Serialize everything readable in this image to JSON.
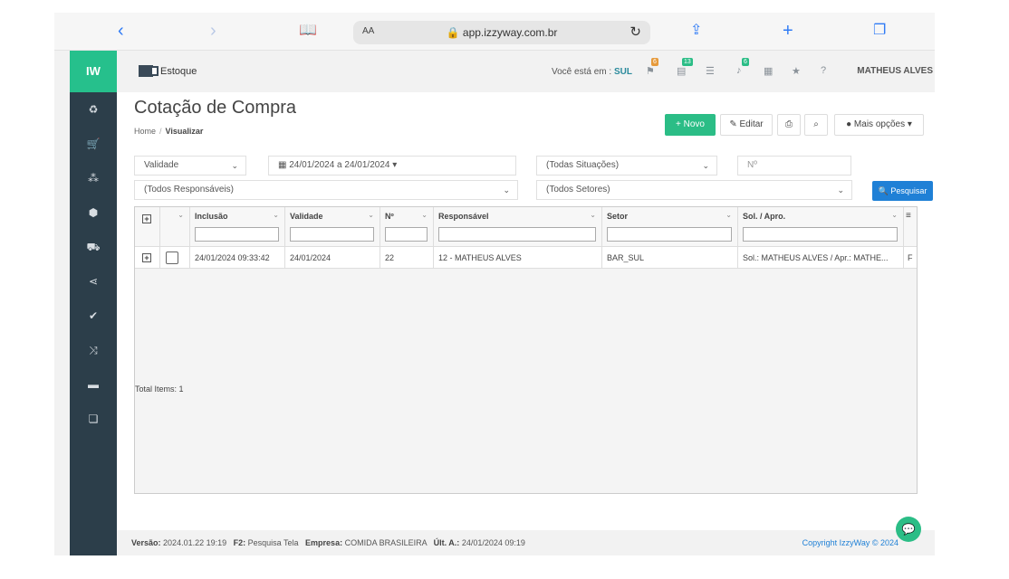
{
  "browser": {
    "text_size": "AA",
    "url": "app.izzyway.com.br"
  },
  "sidebar": {
    "logo": "IW",
    "icons": [
      "recycle-icon",
      "cart-icon",
      "cubes-icon",
      "cube-icon",
      "truck-icon",
      "share-icon",
      "check-circle-icon",
      "shuffle-icon",
      "card-icon",
      "copy-icon"
    ]
  },
  "header": {
    "module": "Estoque",
    "you_are_label": "Você está em :",
    "location": "SUL",
    "badges": {
      "orders": "6",
      "messages": "13",
      "alerts": "6"
    },
    "badge_colors": {
      "orders": "#e69a3b",
      "messages": "#2bbd86",
      "alerts": "#2bbd86"
    },
    "user": "MATHEUS ALVES"
  },
  "page": {
    "title": "Cotação de Compra",
    "breadcrumb_home": "Home",
    "breadcrumb_current": "Visualizar"
  },
  "toolbar": {
    "new_label": "+ Novo",
    "edit_label": "✎ Editar",
    "more_label": "● Mais opções ▾",
    "search_button": "🔍 Pesquisar"
  },
  "filters": {
    "validity": "Validade",
    "date_range": "▦ 24/01/2024 a 24/01/2024 ▾",
    "situations": "(Todas Situações)",
    "number_placeholder": "Nº",
    "responsibles": "(Todos Responsáveis)",
    "sectors": "(Todos Setores)"
  },
  "grid": {
    "columns": [
      "Inclusão",
      "Validade",
      "Nº",
      "Responsável",
      "Setor",
      "Sol. / Apro."
    ],
    "rows": [
      {
        "inclusao": "24/01/2024 09:33:42",
        "validade": "24/01/2024",
        "numero": "22",
        "responsavel": "12 - MATHEUS ALVES",
        "setor": "BAR_SUL",
        "sol_apro": "Sol.: MATHEUS ALVES / Apr.: MATHE...",
        "extra": "F"
      }
    ],
    "total_items": "Total Items: 1"
  },
  "footer": {
    "version_label": "Versão:",
    "version": "2024.01.22 19:19",
    "f2_label": "F2:",
    "f2_text": "Pesquisa Tela",
    "company_label": "Empresa:",
    "company": "COMIDA BRASILEIRA",
    "last_label": "Últ. A.:",
    "last": "24/01/2024 09:19",
    "copyright": "Copyright IzzyWay © 2024"
  }
}
